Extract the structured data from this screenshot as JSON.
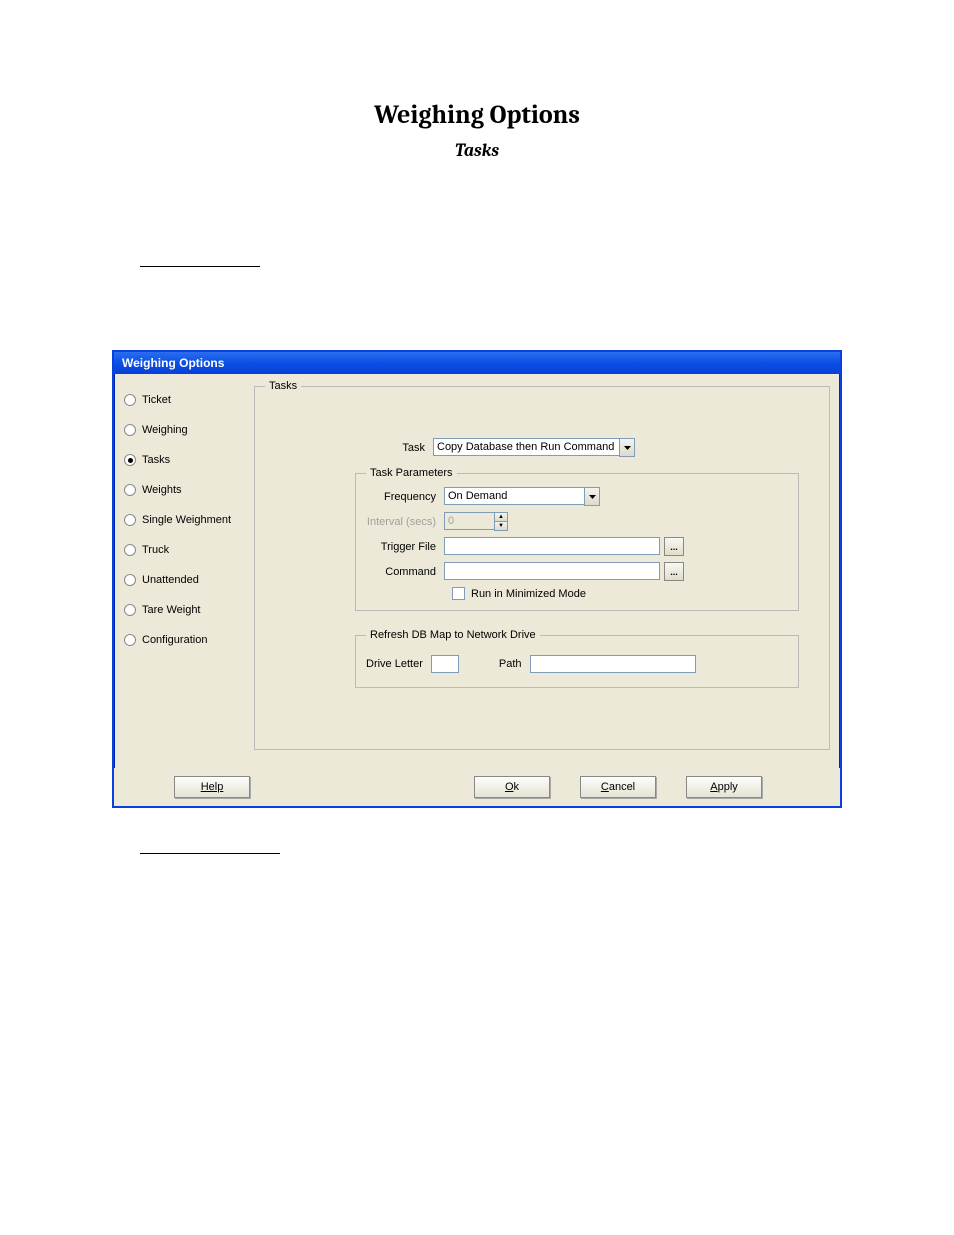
{
  "page": {
    "title": "Weighing Options",
    "subtitle": "Tasks"
  },
  "dialog": {
    "title": "Weighing Options",
    "sidebar": {
      "items": [
        {
          "label": "Ticket",
          "selected": false
        },
        {
          "label": "Weighing",
          "selected": false
        },
        {
          "label": "Tasks",
          "selected": true
        },
        {
          "label": "Weights",
          "selected": false
        },
        {
          "label": "Single Weighment",
          "selected": false
        },
        {
          "label": "Truck",
          "selected": false
        },
        {
          "label": "Unattended",
          "selected": false
        },
        {
          "label": "Tare Weight",
          "selected": false
        },
        {
          "label": "Configuration",
          "selected": false
        }
      ]
    },
    "tasks_group_label": "Tasks",
    "task_field_label": "Task",
    "task_value": "Copy Database then Run Command",
    "task_params_label": "Task Parameters",
    "frequency_label": "Frequency",
    "frequency_value": "On Demand",
    "interval_label": "Interval (secs)",
    "interval_value": "0",
    "trigger_file_label": "Trigger File",
    "trigger_file_value": "",
    "command_label": "Command",
    "command_value": "",
    "run_minimized_label": "Run in Minimized Mode",
    "run_minimized_checked": false,
    "refresh_group_label": "Refresh DB Map to Network Drive",
    "drive_letter_label": "Drive Letter",
    "drive_letter_value": "",
    "path_label": "Path",
    "path_value": "",
    "browse_label": "...",
    "buttons": {
      "help": "Help",
      "ok_prefix": "O",
      "ok_rest": "k",
      "cancel_prefix": "C",
      "cancel_rest": "ancel",
      "apply_prefix": "A",
      "apply_rest": "pply"
    }
  }
}
